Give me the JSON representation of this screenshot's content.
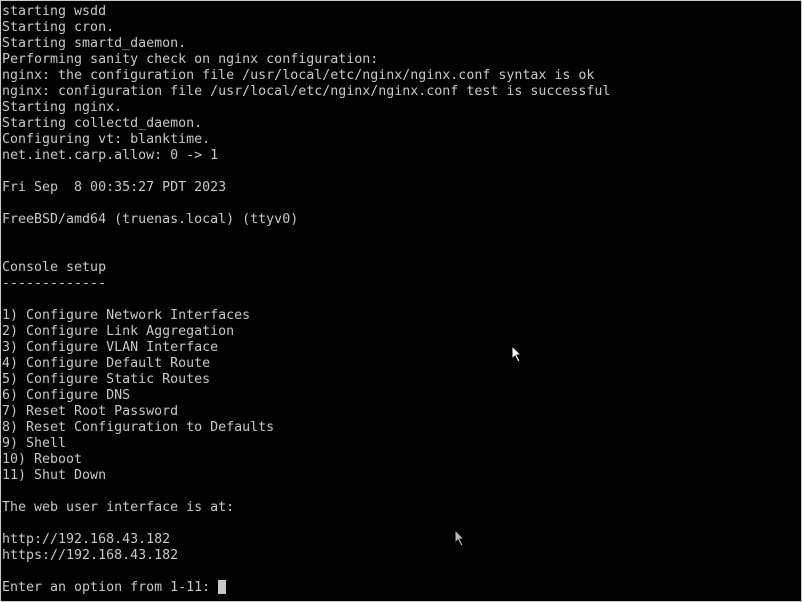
{
  "console": {
    "lines": [
      "starting wsdd",
      "Starting cron.",
      "Starting smartd_daemon.",
      "Performing sanity check on nginx configuration:",
      "nginx: the configuration file /usr/local/etc/nginx/nginx.conf syntax is ok",
      "nginx: configuration file /usr/local/etc/nginx/nginx.conf test is successful",
      "Starting nginx.",
      "Starting collectd_daemon.",
      "Configuring vt: blanktime.",
      "net.inet.carp.allow: 0 -> 1",
      "",
      "Fri Sep  8 00:35:27 PDT 2023",
      "",
      "FreeBSD/amd64 (truenas.local) (ttyv0)",
      "",
      "",
      "Console setup",
      "-------------",
      "",
      "1) Configure Network Interfaces",
      "2) Configure Link Aggregation",
      "3) Configure VLAN Interface",
      "4) Configure Default Route",
      "5) Configure Static Routes",
      "6) Configure DNS",
      "7) Reset Root Password",
      "8) Reset Configuration to Defaults",
      "9) Shell",
      "10) Reboot",
      "11) Shut Down",
      "",
      "The web user interface is at:",
      "",
      "http://192.168.43.182",
      "https://192.168.43.182",
      ""
    ],
    "prompt": "Enter an option from 1-11: ",
    "input_value": ""
  },
  "colors": {
    "foreground": "#c8c8c8",
    "background": "#000000"
  }
}
